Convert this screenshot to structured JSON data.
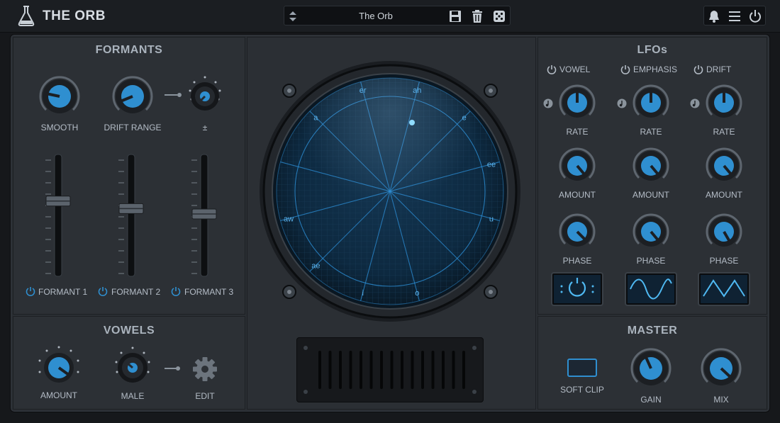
{
  "header": {
    "app_title": "THE ORB",
    "preset_name": "The Orb",
    "icons": [
      "flask-icon",
      "preset-arrows-icon",
      "save-icon",
      "trash-icon",
      "dice-icon",
      "bell-icon",
      "menu-icon",
      "power-icon"
    ]
  },
  "formants": {
    "title": "FORMANTS",
    "smooth_label": "SMOOTH",
    "drift_range_label": "DRIFT RANGE",
    "plusminus_label": "±",
    "faders": [
      {
        "label": "FORMANT 1",
        "level": 0.62
      },
      {
        "label": "FORMANT 2",
        "level": 0.55
      },
      {
        "label": "FORMANT 3",
        "level": 0.5
      }
    ]
  },
  "vowels": {
    "title": "VOWELS",
    "amount_label": "AMOUNT",
    "male_label": "MALE",
    "edit_label": "EDIT"
  },
  "orb": {
    "vowel_labels": [
      "er",
      "ah",
      "e",
      "ee",
      "u",
      "o",
      "i",
      "ae",
      "aw",
      "a"
    ]
  },
  "lfos": {
    "title": "LFOs",
    "columns": [
      {
        "name": "VOWEL",
        "rate": "RATE",
        "amount": "AMOUNT",
        "phase": "PHASE",
        "shape": "random"
      },
      {
        "name": "EMPHASIS",
        "rate": "RATE",
        "amount": "AMOUNT",
        "phase": "PHASE",
        "shape": "sine"
      },
      {
        "name": "DRIFT",
        "rate": "RATE",
        "amount": "AMOUNT",
        "phase": "PHASE",
        "shape": "triangle"
      }
    ]
  },
  "master": {
    "title": "MASTER",
    "soft_clip_label": "SOFT CLIP",
    "gain_label": "GAIN",
    "mix_label": "MIX"
  },
  "colors": {
    "accent": "#2f8fd0",
    "screen_line": "#2c8ed6",
    "panel": "#2c3035",
    "background": "#16181b"
  }
}
